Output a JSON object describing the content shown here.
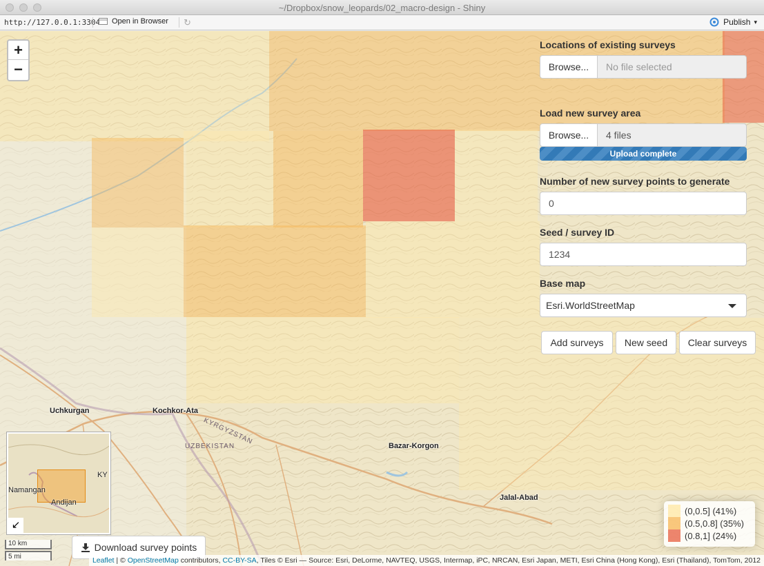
{
  "window": {
    "title": "~/Dropbox/snow_leopards/02_macro-design - Shiny"
  },
  "toolbar": {
    "url": "http://127.0.0.1:3304",
    "open_in_browser": "Open in Browser",
    "publish": "Publish"
  },
  "map": {
    "zoom_in": "+",
    "zoom_out": "−",
    "cities": {
      "uchkurgan": "Uchkurgan",
      "kochkor_ata": "Kochkor-Ata",
      "bazar_korgon": "Bazar-Korgon",
      "jalal_abad": "Jalal-Abad"
    },
    "countries": {
      "kyrgyzstan": "KYRGYZSTAN",
      "uzbekistan": "UZBEKISTAN"
    },
    "minimap": {
      "namangan": "Namangan",
      "andijan": "Andijan",
      "ky": "KY",
      "toggle": "↙"
    },
    "scale": {
      "metric": "10 km",
      "imperial": "5 mi"
    },
    "download_button": "Download survey points",
    "legend": [
      {
        "label": "(0,0.5] (41%)",
        "color": "#ffe9a8"
      },
      {
        "label": "(0.5,0.8] (35%)",
        "color": "#f7b95c"
      },
      {
        "label": "(0.8,1] (24%)",
        "color": "#e8674a"
      }
    ],
    "attribution": {
      "leaflet": "Leaflet",
      "pipe": " | © ",
      "osm": "OpenStreetMap",
      "contributors": " contributors, ",
      "license": "CC-BY-SA",
      "tiles": ", Tiles © Esri — Source: Esri, DeLorme, NAVTEQ, USGS, Intermap, iPC, NRCAN, Esri Japan, METI, Esri China (Hong Kong), Esri (Thailand), TomTom, 2012"
    }
  },
  "panel": {
    "existing_surveys": {
      "label": "Locations of existing surveys",
      "browse": "Browse...",
      "filename": "No file selected"
    },
    "new_area": {
      "label": "Load new survey area",
      "browse": "Browse...",
      "filename": "4 files",
      "progress_text": "Upload complete",
      "progress": 1.0
    },
    "num_points": {
      "label": "Number of new survey points to generate",
      "value": "0"
    },
    "seed": {
      "label": "Seed / survey ID",
      "value": "1234"
    },
    "base_map": {
      "label": "Base map",
      "selected": "Esri.WorldStreetMap"
    },
    "buttons": {
      "add": "Add surveys",
      "new_seed": "New seed",
      "clear": "Clear surveys"
    }
  }
}
